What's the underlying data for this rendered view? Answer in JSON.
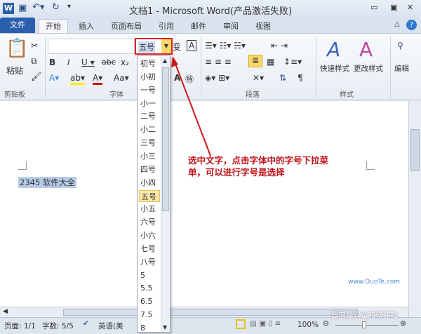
{
  "window": {
    "title": "文档1 - Microsoft Word(产品激活失败)"
  },
  "tabs": [
    "文件",
    "开始",
    "插入",
    "页面布局",
    "引用",
    "邮件",
    "审阅",
    "视图"
  ],
  "ribbon": {
    "clipboard": {
      "paste": "粘贴",
      "label": "剪贴板"
    },
    "font": {
      "label": "字体",
      "font_size_value": "五号"
    },
    "paragraph": {
      "label": "段落"
    },
    "styles": {
      "quick": "快速样式",
      "change": "更改样式",
      "label": "样式"
    },
    "editing": {
      "label": "编辑"
    }
  },
  "font_size_options": [
    "初号",
    "小初",
    "一号",
    "小一",
    "二号",
    "小二",
    "三号",
    "小三",
    "四号",
    "小四",
    "五号",
    "小五",
    "六号",
    "小六",
    "七号",
    "八号",
    "5",
    "5.5",
    "6.5",
    "7.5",
    "8"
  ],
  "selected_size": "五号",
  "document": {
    "text": "2345 软件大全"
  },
  "annotation": "选中文字，点击字体中的字号下拉菜单，可以进行字号是选择",
  "status": {
    "page": "页面: 1/1",
    "words": "字数: 5/5",
    "language": "英语(美",
    "zoom": "100%"
  },
  "watermark": {
    "url": "www.DuoTe.com",
    "text": "国内最安全的软件站"
  },
  "colors": {
    "accent": "#2a5fad",
    "annotation": "#c0141a",
    "highlight": "#fde9a8"
  }
}
